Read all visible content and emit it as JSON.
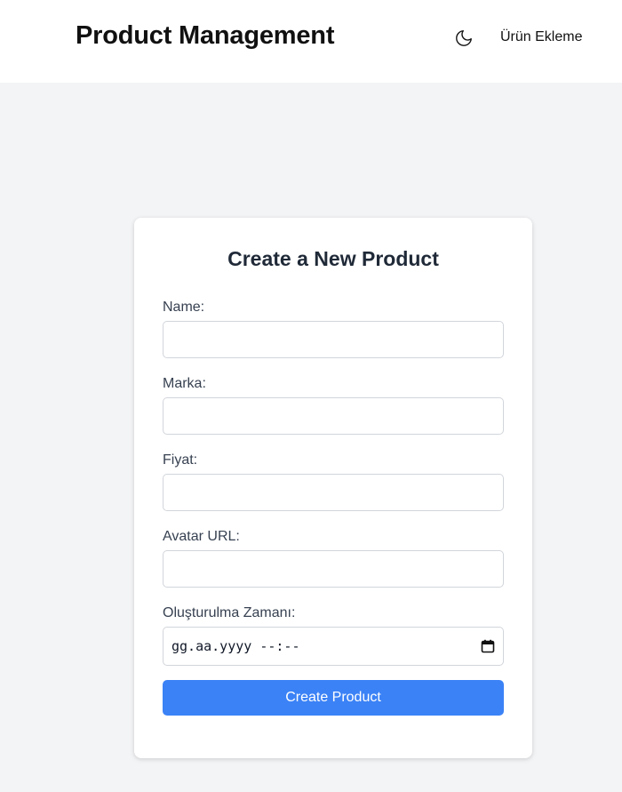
{
  "header": {
    "title": "Product Management",
    "theme_icon": "moon-icon",
    "nav_link": "Ürün Ekleme"
  },
  "form": {
    "title": "Create a New Product",
    "fields": [
      {
        "label": "Name:",
        "value": ""
      },
      {
        "label": "Marka:",
        "value": ""
      },
      {
        "label": "Fiyat:",
        "value": ""
      },
      {
        "label": "Avatar URL:",
        "value": ""
      }
    ],
    "date_field": {
      "label": "Oluşturulma Zamanı:",
      "placeholder": "gg.aa.yyyy --:--",
      "icon": "calendar-icon"
    },
    "submit_label": "Create Product"
  },
  "colors": {
    "primary": "#3b82f6",
    "page_background": "#f3f4f6",
    "card_background": "#ffffff"
  }
}
